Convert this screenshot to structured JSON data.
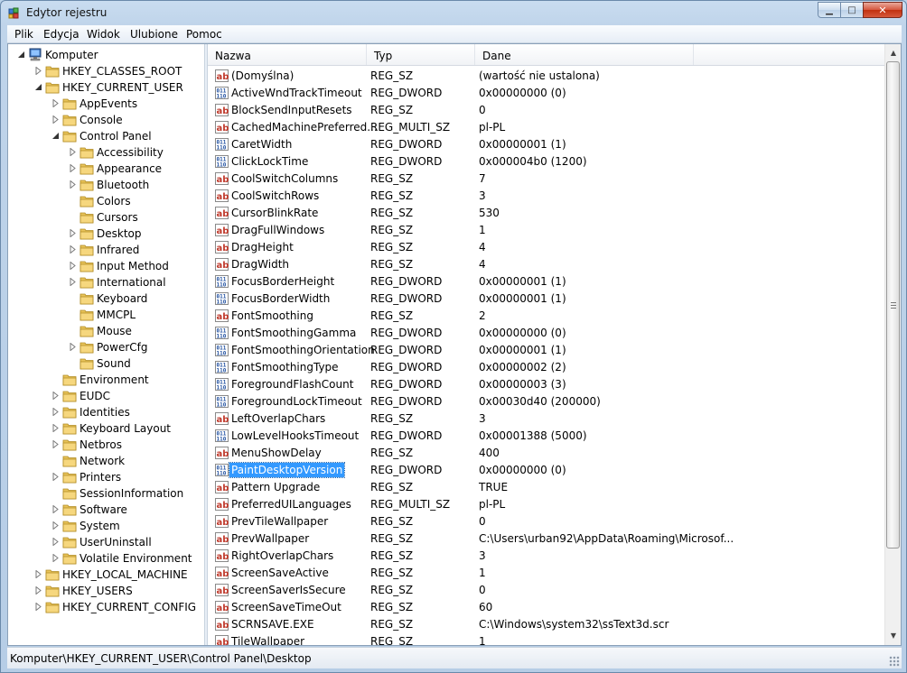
{
  "window": {
    "title": "Edytor rejestru"
  },
  "menu": [
    "Plik",
    "Edycja",
    "Widok",
    "Ulubione",
    "Pomoc"
  ],
  "tree": [
    {
      "label": "Komputer",
      "level": 0,
      "state": "expanded",
      "icon": "computer-icon"
    },
    {
      "label": "HKEY_CLASSES_ROOT",
      "level": 1,
      "state": "collapsed"
    },
    {
      "label": "HKEY_CURRENT_USER",
      "level": 1,
      "state": "expanded"
    },
    {
      "label": "AppEvents",
      "level": 2,
      "state": "collapsed"
    },
    {
      "label": "Console",
      "level": 2,
      "state": "collapsed"
    },
    {
      "label": "Control Panel",
      "level": 2,
      "state": "expanded"
    },
    {
      "label": "Accessibility",
      "level": 3,
      "state": "collapsed"
    },
    {
      "label": "Appearance",
      "level": 3,
      "state": "collapsed"
    },
    {
      "label": "Bluetooth",
      "level": 3,
      "state": "collapsed"
    },
    {
      "label": "Colors",
      "level": 3,
      "state": "none"
    },
    {
      "label": "Cursors",
      "level": 3,
      "state": "none"
    },
    {
      "label": "Desktop",
      "level": 3,
      "state": "collapsed"
    },
    {
      "label": "Infrared",
      "level": 3,
      "state": "collapsed"
    },
    {
      "label": "Input Method",
      "level": 3,
      "state": "collapsed"
    },
    {
      "label": "International",
      "level": 3,
      "state": "collapsed"
    },
    {
      "label": "Keyboard",
      "level": 3,
      "state": "none"
    },
    {
      "label": "MMCPL",
      "level": 3,
      "state": "none"
    },
    {
      "label": "Mouse",
      "level": 3,
      "state": "none"
    },
    {
      "label": "PowerCfg",
      "level": 3,
      "state": "collapsed"
    },
    {
      "label": "Sound",
      "level": 3,
      "state": "none"
    },
    {
      "label": "Environment",
      "level": 2,
      "state": "none"
    },
    {
      "label": "EUDC",
      "level": 2,
      "state": "collapsed"
    },
    {
      "label": "Identities",
      "level": 2,
      "state": "collapsed"
    },
    {
      "label": "Keyboard Layout",
      "level": 2,
      "state": "collapsed"
    },
    {
      "label": "Netbros",
      "level": 2,
      "state": "collapsed"
    },
    {
      "label": "Network",
      "level": 2,
      "state": "none"
    },
    {
      "label": "Printers",
      "level": 2,
      "state": "collapsed"
    },
    {
      "label": "SessionInformation",
      "level": 2,
      "state": "none"
    },
    {
      "label": "Software",
      "level": 2,
      "state": "collapsed"
    },
    {
      "label": "System",
      "level": 2,
      "state": "collapsed"
    },
    {
      "label": "UserUninstall",
      "level": 2,
      "state": "collapsed"
    },
    {
      "label": "Volatile Environment",
      "level": 2,
      "state": "collapsed"
    },
    {
      "label": "HKEY_LOCAL_MACHINE",
      "level": 1,
      "state": "collapsed"
    },
    {
      "label": "HKEY_USERS",
      "level": 1,
      "state": "collapsed"
    },
    {
      "label": "HKEY_CURRENT_CONFIG",
      "level": 1,
      "state": "collapsed"
    }
  ],
  "columns": {
    "name": "Nazwa",
    "type": "Typ",
    "data": "Dane"
  },
  "values": [
    {
      "name": "(Domyślna)",
      "type": "REG_SZ",
      "data": "(wartość nie ustalona)",
      "icon": "string-value-icon"
    },
    {
      "name": "ActiveWndTrackTimeout",
      "type": "REG_DWORD",
      "data": "0x00000000 (0)",
      "icon": "binary-value-icon"
    },
    {
      "name": "BlockSendInputResets",
      "type": "REG_SZ",
      "data": "0",
      "icon": "string-value-icon"
    },
    {
      "name": "CachedMachinePreferred...",
      "type": "REG_MULTI_SZ",
      "data": "pl-PL",
      "icon": "string-value-icon"
    },
    {
      "name": "CaretWidth",
      "type": "REG_DWORD",
      "data": "0x00000001 (1)",
      "icon": "binary-value-icon"
    },
    {
      "name": "ClickLockTime",
      "type": "REG_DWORD",
      "data": "0x000004b0 (1200)",
      "icon": "binary-value-icon"
    },
    {
      "name": "CoolSwitchColumns",
      "type": "REG_SZ",
      "data": "7",
      "icon": "string-value-icon"
    },
    {
      "name": "CoolSwitchRows",
      "type": "REG_SZ",
      "data": "3",
      "icon": "string-value-icon"
    },
    {
      "name": "CursorBlinkRate",
      "type": "REG_SZ",
      "data": "530",
      "icon": "string-value-icon"
    },
    {
      "name": "DragFullWindows",
      "type": "REG_SZ",
      "data": "1",
      "icon": "string-value-icon"
    },
    {
      "name": "DragHeight",
      "type": "REG_SZ",
      "data": "4",
      "icon": "string-value-icon"
    },
    {
      "name": "DragWidth",
      "type": "REG_SZ",
      "data": "4",
      "icon": "string-value-icon"
    },
    {
      "name": "FocusBorderHeight",
      "type": "REG_DWORD",
      "data": "0x00000001 (1)",
      "icon": "binary-value-icon"
    },
    {
      "name": "FocusBorderWidth",
      "type": "REG_DWORD",
      "data": "0x00000001 (1)",
      "icon": "binary-value-icon"
    },
    {
      "name": "FontSmoothing",
      "type": "REG_SZ",
      "data": "2",
      "icon": "string-value-icon"
    },
    {
      "name": "FontSmoothingGamma",
      "type": "REG_DWORD",
      "data": "0x00000000 (0)",
      "icon": "binary-value-icon"
    },
    {
      "name": "FontSmoothingOrientation",
      "type": "REG_DWORD",
      "data": "0x00000001 (1)",
      "icon": "binary-value-icon"
    },
    {
      "name": "FontSmoothingType",
      "type": "REG_DWORD",
      "data": "0x00000002 (2)",
      "icon": "binary-value-icon"
    },
    {
      "name": "ForegroundFlashCount",
      "type": "REG_DWORD",
      "data": "0x00000003 (3)",
      "icon": "binary-value-icon"
    },
    {
      "name": "ForegroundLockTimeout",
      "type": "REG_DWORD",
      "data": "0x00030d40 (200000)",
      "icon": "binary-value-icon"
    },
    {
      "name": "LeftOverlapChars",
      "type": "REG_SZ",
      "data": "3",
      "icon": "string-value-icon"
    },
    {
      "name": "LowLevelHooksTimeout",
      "type": "REG_DWORD",
      "data": "0x00001388 (5000)",
      "icon": "binary-value-icon"
    },
    {
      "name": "MenuShowDelay",
      "type": "REG_SZ",
      "data": "400",
      "icon": "string-value-icon"
    },
    {
      "name": "PaintDesktopVersion",
      "type": "REG_DWORD",
      "data": "0x00000000 (0)",
      "icon": "binary-value-icon",
      "selected": true
    },
    {
      "name": "Pattern Upgrade",
      "type": "REG_SZ",
      "data": "TRUE",
      "icon": "string-value-icon"
    },
    {
      "name": "PreferredUILanguages",
      "type": "REG_MULTI_SZ",
      "data": "pl-PL",
      "icon": "string-value-icon"
    },
    {
      "name": "PrevTileWallpaper",
      "type": "REG_SZ",
      "data": "0",
      "icon": "string-value-icon"
    },
    {
      "name": "PrevWallpaper",
      "type": "REG_SZ",
      "data": "C:\\Users\\urban92\\AppData\\Roaming\\Microsof...",
      "icon": "string-value-icon"
    },
    {
      "name": "RightOverlapChars",
      "type": "REG_SZ",
      "data": "3",
      "icon": "string-value-icon"
    },
    {
      "name": "ScreenSaveActive",
      "type": "REG_SZ",
      "data": "1",
      "icon": "string-value-icon"
    },
    {
      "name": "ScreenSaverIsSecure",
      "type": "REG_SZ",
      "data": "0",
      "icon": "string-value-icon"
    },
    {
      "name": "ScreenSaveTimeOut",
      "type": "REG_SZ",
      "data": "60",
      "icon": "string-value-icon"
    },
    {
      "name": "SCRNSAVE.EXE",
      "type": "REG_SZ",
      "data": "C:\\Windows\\system32\\ssText3d.scr",
      "icon": "string-value-icon"
    },
    {
      "name": "TileWallpaper",
      "type": "REG_SZ",
      "data": "1",
      "icon": "string-value-icon"
    }
  ],
  "status": {
    "path": "Komputer\\HKEY_CURRENT_USER\\Control Panel\\Desktop"
  },
  "colors": {
    "selection": "#3399ff",
    "folder": "#e8c35a"
  }
}
